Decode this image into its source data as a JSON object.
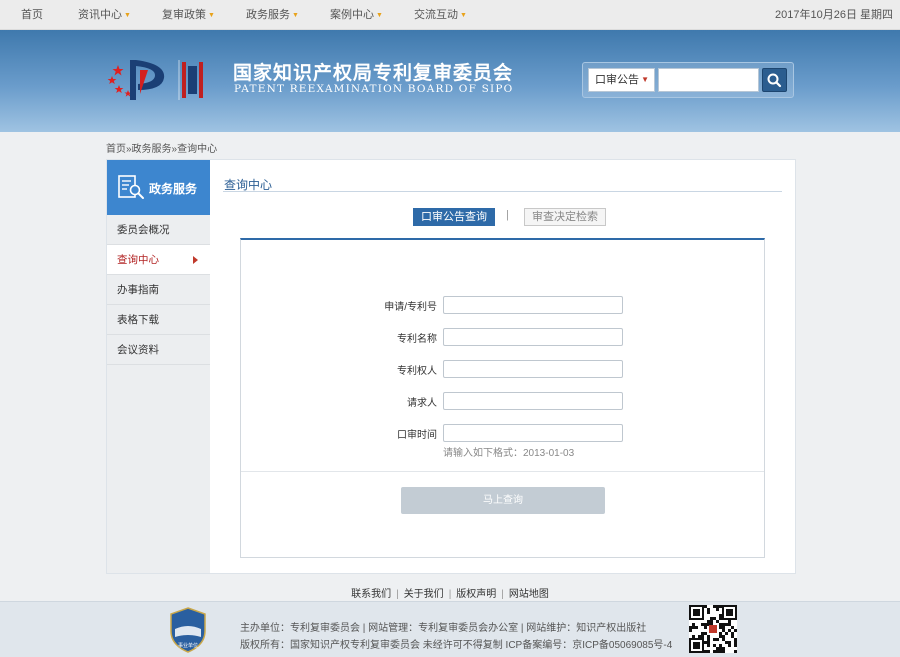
{
  "topnav": {
    "items": [
      {
        "label": "首页"
      },
      {
        "label": "资讯中心"
      },
      {
        "label": "复审政策"
      },
      {
        "label": "政务服务"
      },
      {
        "label": "案例中心"
      },
      {
        "label": "交流互动"
      }
    ],
    "arrow_glyph": "▼",
    "date": "2017年10月26日 星期四"
  },
  "header": {
    "title_cn": "国家知识产权局专利复审委员会",
    "title_en": "PATENT REEXAMINATION BOARD OF SIPO",
    "search_select_value": "口审公告",
    "search_placeholder": "",
    "search_icon": "search-icon"
  },
  "breadcrumb": "首页»政务服务»查询中心",
  "sidebar": {
    "heading": "政务服务",
    "items": [
      {
        "label": "委员会概况"
      },
      {
        "label": "查询中心"
      },
      {
        "label": "办事指南"
      },
      {
        "label": "表格下载"
      },
      {
        "label": "会议资料"
      }
    ]
  },
  "main": {
    "title": "查询中心",
    "tabs": [
      {
        "label": "口审公告查询"
      },
      {
        "label": "审查决定检索"
      }
    ],
    "tab_separator": "|",
    "form": {
      "fields": [
        {
          "label": "申请/专利号",
          "value": ""
        },
        {
          "label": "专利名称",
          "value": ""
        },
        {
          "label": "专利权人",
          "value": ""
        },
        {
          "label": "请求人",
          "value": ""
        },
        {
          "label": "口审时间",
          "value": ""
        }
      ],
      "hint": "请输入如下格式：2013-01-03",
      "submit_label": "马上查询"
    }
  },
  "footer_links": {
    "items": [
      {
        "label": "联系我们"
      },
      {
        "label": "关于我们"
      },
      {
        "label": "版权声明"
      },
      {
        "label": "网站地图"
      }
    ],
    "separator": "|"
  },
  "footer": {
    "line1": "主办单位：专利复审委员会 | 网站管理：专利复审委员会办公室 | 网站维护：知识产权出版社",
    "line2": "版权所有：国家知识产权专利复审委员会 未经许可不得复制 ICP备案编号：京ICP备05069085号-4",
    "badge_text": "事业单位"
  },
  "colors": {
    "brand_blue": "#2e6aa8",
    "accent_red": "#c0392b",
    "nav_arrow": "#e8a21b"
  }
}
